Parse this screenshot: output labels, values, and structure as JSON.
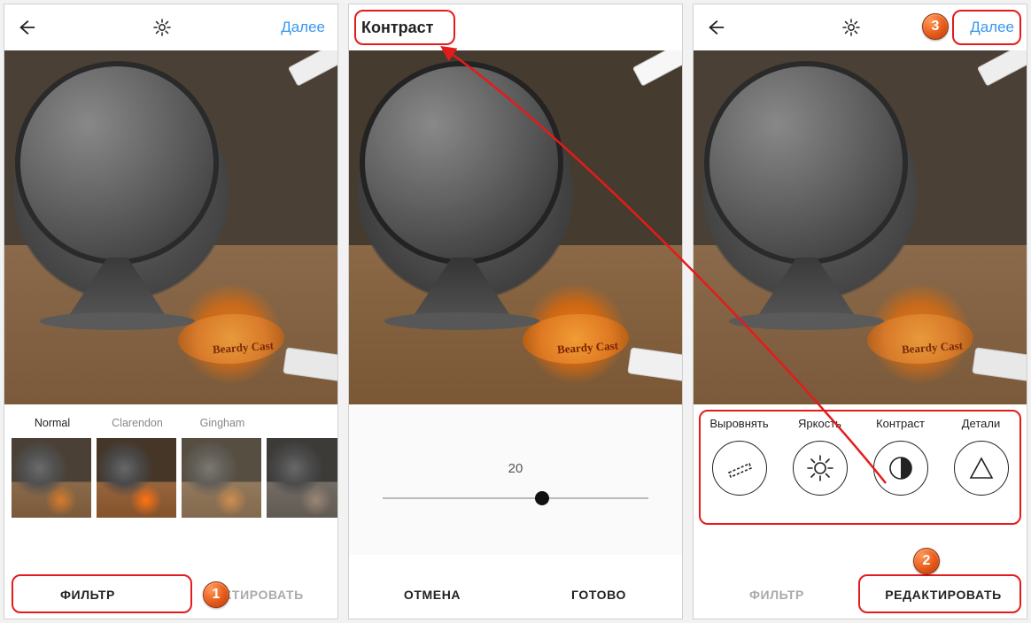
{
  "screen1": {
    "next": "Далее",
    "filters": [
      {
        "name": "Normal",
        "selected": true
      },
      {
        "name": "Clarendon",
        "selected": false
      },
      {
        "name": "Gingham",
        "selected": false
      },
      {
        "name": "",
        "selected": false
      }
    ],
    "tabs": {
      "filter": "ФИЛЬТР",
      "edit": "ДАКТИРОВАТЬ"
    }
  },
  "screen2": {
    "title": "Контраст",
    "slider": {
      "value": "20",
      "min": -100,
      "max": 100
    },
    "tabs": {
      "cancel": "ОТМЕНА",
      "done": "ГОТОВО"
    }
  },
  "screen3": {
    "next": "Далее",
    "tools": [
      {
        "key": "adjust",
        "label": "Выровнять"
      },
      {
        "key": "brightness",
        "label": "Яркость"
      },
      {
        "key": "contrast",
        "label": "Контраст"
      },
      {
        "key": "structure",
        "label": "Детали"
      }
    ],
    "tabs": {
      "filter": "ФИЛЬТР",
      "edit": "РЕДАКТИРОВАТЬ"
    }
  },
  "annotations": {
    "step1": "1",
    "step2": "2",
    "step3": "3"
  },
  "photo_prop_text": "Beardy Cast"
}
